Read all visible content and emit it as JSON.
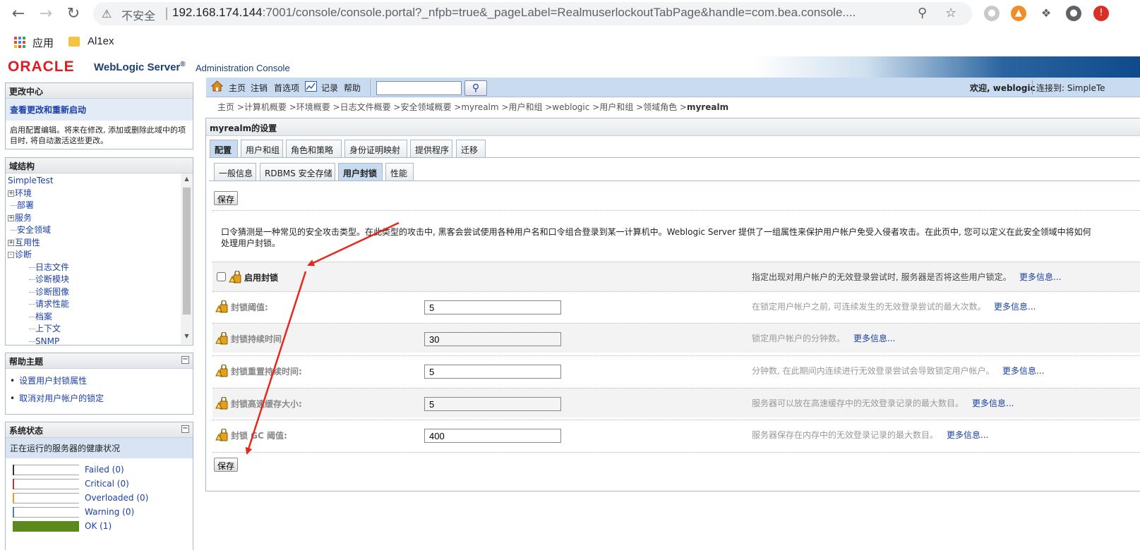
{
  "browser": {
    "insecure_label": "不安全",
    "url_host": "192.168.174.144",
    "url_rest": ":7001/console/console.portal?_nfpb=true&_pageLabel=RealmuserlockoutTabPage&handle=com.bea.console....",
    "bookmarks": [
      "应用",
      "Al1ex"
    ]
  },
  "header": {
    "oracle": "ORACLE",
    "product": "WebLogic Server",
    "reg": "®",
    "subtitle": "Administration Console"
  },
  "change_center": {
    "title": "更改中心",
    "link": "查看更改和重新启动",
    "text": "启用配置编辑。将来在修改, 添加或删除此域中的项目时, 将自动激活这些更改。"
  },
  "domain_structure": {
    "title": "域结构",
    "root": "SimpleTest",
    "items": [
      {
        "label": "环境",
        "expand": "+"
      },
      {
        "label": "部署",
        "expand": ""
      },
      {
        "label": "服务",
        "expand": "+"
      },
      {
        "label": "安全领域",
        "expand": ""
      },
      {
        "label": "互用性",
        "expand": "+"
      },
      {
        "label": "诊断",
        "expand": "-"
      }
    ],
    "children": [
      "日志文件",
      "诊断模块",
      "诊断图像",
      "请求性能",
      "档案",
      "上下文",
      "SNMP"
    ]
  },
  "help_topics": {
    "title": "帮助主题",
    "items": [
      "设置用户封锁属性",
      "取消对用户帐户的锁定"
    ]
  },
  "system_status": {
    "title": "系统状态",
    "subtitle": "正在运行的服务器的健康状况",
    "rows": [
      {
        "label": "Failed (0)",
        "color": "#333333",
        "fill": 0
      },
      {
        "label": "Critical (0)",
        "color": "#d62c2c",
        "fill": 0
      },
      {
        "label": "Overloaded (0)",
        "color": "#e0a020",
        "fill": 0
      },
      {
        "label": "Warning (0)",
        "color": "#4a7fc1",
        "fill": 0
      },
      {
        "label": "OK (1)",
        "color": "#5a8a1e",
        "fill": 1
      }
    ]
  },
  "toolbar": {
    "home": "主页",
    "logout": "注销",
    "prefs": "首选项",
    "record": "记录",
    "help": "帮助",
    "search_value": "",
    "welcome": "欢迎, weblogic",
    "connected": "连接到: SimpleTe"
  },
  "breadcrumb": {
    "parts": "主页 >计算机概要 >环境概要 >日志文件概要 >安全领域概要 >myrealm >用户和组 >weblogic >用户和组 >领域角色 >",
    "current": "myrealm"
  },
  "settings": {
    "title": "myrealm的设置",
    "tabs": [
      "配置",
      "用户和组",
      "角色和策略",
      "身份证明映射",
      "提供程序",
      "迁移"
    ],
    "subtabs": [
      "一般信息",
      "RDBMS 安全存储",
      "用户封锁",
      "性能"
    ],
    "save": "保存",
    "description": "口令猜测是一种常见的安全攻击类型。在此类型的攻击中, 黑客会尝试使用各种用户名和口令组合登录到某一计算机中。Weblogic Server 提供了一组属性来保护用户帐户免受入侵者攻击。在此页中, 您可以定义在此安全领域中将如何处理用户封锁。",
    "more": "更多信息...",
    "enable": {
      "label": "启用封锁",
      "checked": false,
      "help": "指定出现对用户帐户的无效登录尝试时, 服务器是否将这些用户锁定。"
    },
    "fields": [
      {
        "label": "封锁阈值:",
        "value": "5",
        "help": "在锁定用户帐户之前, 可连续发生的无效登录尝试的最大次数。"
      },
      {
        "label": "封锁持续时间",
        "value": "30",
        "help": "锁定用户帐户的分钟数。"
      },
      {
        "label": "封锁重置持续时间:",
        "value": "5",
        "help": "分钟数, 在此期间内连续进行无效登录尝试会导致锁定用户帐户。"
      },
      {
        "label": "封锁高速缓存大小:",
        "value": "5",
        "help": "服务器可以放在高速缓存中的无效登录记录的最大数目。"
      },
      {
        "label": "封锁 GC 阈值:",
        "value": "400",
        "help": "服务器保存在内存中的无效登录记录的最大数目。"
      }
    ]
  },
  "colors": {
    "oracle_red": "#e21b22",
    "link_blue": "#1a3fa8",
    "toolbar_blue": "#c8dbf1",
    "annotation_red": "#e8261c"
  }
}
